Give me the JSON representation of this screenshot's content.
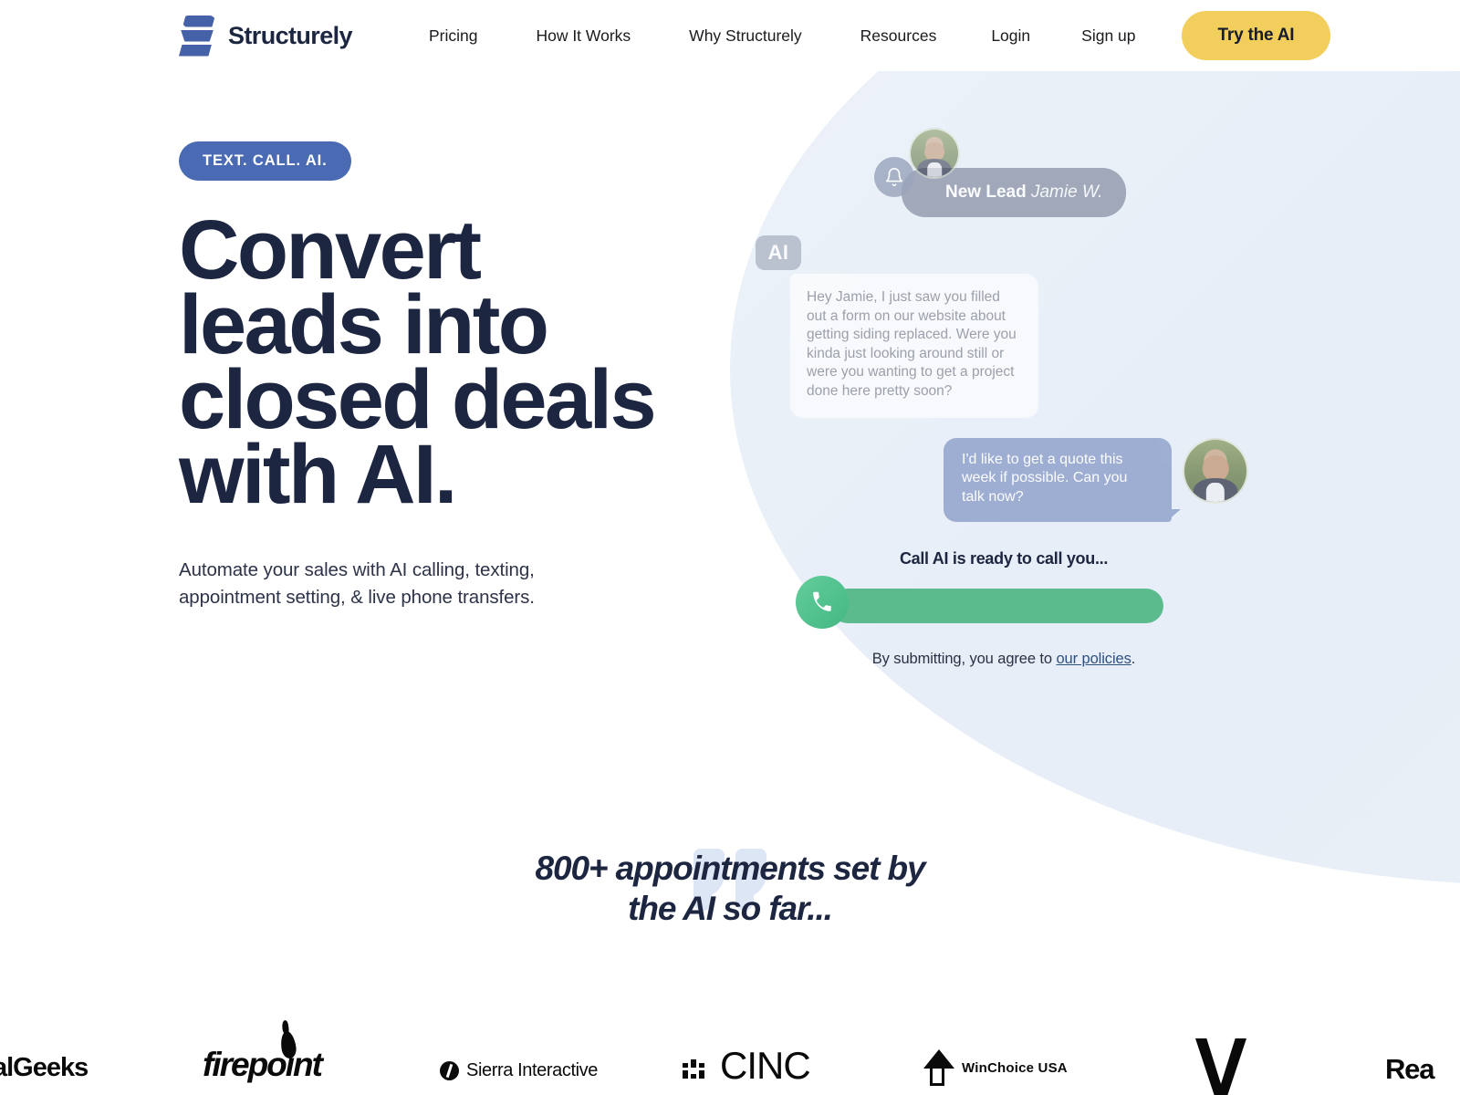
{
  "navbar": {
    "brand_name": "Structurely",
    "logo_icon": "structurely-s-logo",
    "links": [
      {
        "label": "Pricing"
      },
      {
        "label": "How It Works"
      },
      {
        "label": "Why Structurely"
      },
      {
        "label": "Resources"
      }
    ],
    "login_label": "Login",
    "signup_label": "Sign up",
    "cta_label": "Try the AI",
    "cta_color": "#f2cf5d"
  },
  "hero": {
    "eyebrow": "TEXT. CALL. AI.",
    "eyebrow_color": "#4a6bb3",
    "title_line1": "Convert",
    "title_line2": "leads into",
    "title_line3": "closed deals",
    "title_line4": "with AI.",
    "title_color": "#1d2640",
    "subtitle": "Automate your sales with AI calling, texting, appointment setting, & live phone transfers."
  },
  "chat": {
    "notification": {
      "bell_icon": "bell-icon",
      "label_bold": "New Lead",
      "label_name": "Jamie W.",
      "avatar_icon": "lead-avatar"
    },
    "ai_badge": "AI",
    "ai_message": "Hey Jamie, I just saw you filled out a form on our website about getting siding replaced. Were you kinda just looking around still or were you wanting to get a project done here pretty soon?",
    "user_message": "I'd like to get a quote this week if possible. Can you talk now?",
    "user_avatar_icon": "user-avatar",
    "call_heading": "Call AI is ready to call you...",
    "phone_icon": "phone-icon",
    "call_bar_color": "#5bbb8d",
    "policy_prefix": "By submitting, you agree to ",
    "policy_link": "our policies",
    "policy_suffix": "."
  },
  "social_proof": {
    "quote_icon": "quote-mark-icon",
    "line1": "800+ appointments set by",
    "line2": "the AI so far..."
  },
  "partners": {
    "logos": [
      {
        "name": "alGeeks"
      },
      {
        "name": "firepoint"
      },
      {
        "name": "Sierra Interactive"
      },
      {
        "name": "CINC"
      },
      {
        "name": "WinChoice USA"
      },
      {
        "name": "V"
      },
      {
        "name": "Rea"
      }
    ]
  }
}
